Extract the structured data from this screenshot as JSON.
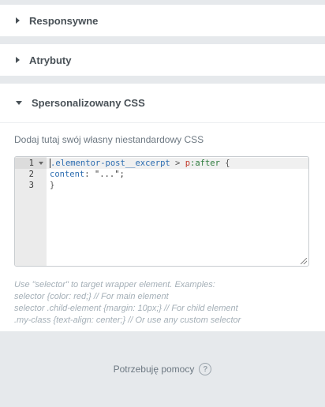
{
  "sections": {
    "responsive": {
      "title": "Responsywne"
    },
    "attributes": {
      "title": "Atrybuty"
    },
    "custom_css": {
      "title": "Spersonalizowany CSS",
      "label": "Dodaj tutaj swój własny niestandardowy CSS",
      "editor": {
        "line_numbers": [
          "1",
          "2",
          "3"
        ],
        "lines": {
          "l1_selector": ".elementor-post__excerpt",
          "l1_op": " > ",
          "l1_tag": "p",
          "l1_pseudo": ":after",
          "l1_brace": " {",
          "l2_prop": "content",
          "l2_rest": ": \"...\";",
          "l3": "}"
        }
      },
      "hint_lines": [
        "Use \"selector\" to target wrapper element. Examples:",
        "selector {color: red;} // For main element",
        "selector .child-element {margin: 10px;} // For child element",
        ".my-class {text-align: center;} // Or use any custom selector"
      ]
    }
  },
  "help": {
    "label": "Potrzebuję pomocy",
    "icon": "question-circle-icon"
  }
}
